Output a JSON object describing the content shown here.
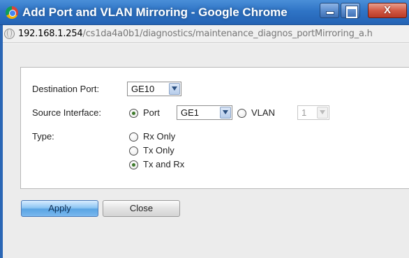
{
  "window": {
    "title": "Add Port and VLAN Mirroring - Google Chrome",
    "close_label": "X"
  },
  "address": {
    "host": "192.168.1.254",
    "path": "/cs1da4a0b1/diagnostics/maintenance_diagnos_portMirroring_a.h"
  },
  "form": {
    "destination_port": {
      "label": "Destination Port:",
      "value": "GE10"
    },
    "source_interface": {
      "label": "Source Interface:",
      "port_option": {
        "label": "Port",
        "checked": true,
        "value": "GE1"
      },
      "vlan_option": {
        "label": "VLAN",
        "checked": false,
        "value": "1",
        "disabled": true
      }
    },
    "type": {
      "label": "Type:",
      "options": [
        {
          "label": "Rx Only",
          "checked": false
        },
        {
          "label": "Tx Only",
          "checked": false
        },
        {
          "label": "Tx and Rx",
          "checked": true
        }
      ]
    }
  },
  "buttons": {
    "apply": "Apply",
    "close": "Close"
  }
}
